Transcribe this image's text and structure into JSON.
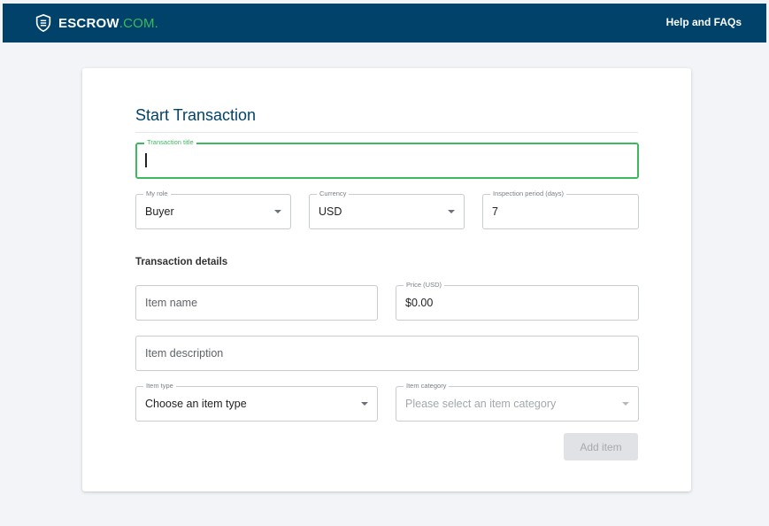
{
  "header": {
    "brand_main": "ESCROW",
    "brand_suffix": ".COM.",
    "help_link": "Help and FAQs",
    "bg_color": "#01426a",
    "accent_color": "#3cb95d",
    "logo_icon": "shield-menu-icon"
  },
  "form": {
    "title": "Start Transaction",
    "transaction_title": {
      "label": "Transaction title",
      "value": ""
    },
    "my_role": {
      "label": "My role",
      "value": "Buyer"
    },
    "currency": {
      "label": "Currency",
      "value": "USD"
    },
    "inspection_period": {
      "label": "Inspection period (days)",
      "value": "7"
    },
    "details_heading": "Transaction details",
    "item_name": {
      "placeholder": "Item name"
    },
    "price": {
      "label": "Price (USD)",
      "value": "$0.00"
    },
    "item_description": {
      "placeholder": "Item description"
    },
    "item_type": {
      "label": "Item type",
      "value": "Choose an item type"
    },
    "item_category": {
      "label": "Item category",
      "placeholder": "Please select an item category"
    },
    "add_item_button": "Add item",
    "add_item_disabled": true
  }
}
